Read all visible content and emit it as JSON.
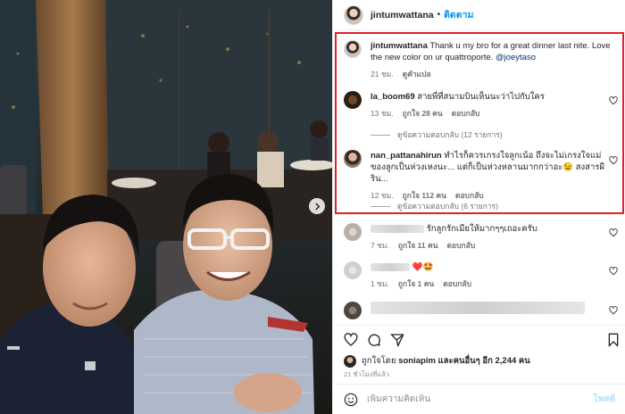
{
  "post": {
    "owner_username": "jintumwattana",
    "follow_label": "ติดตาม",
    "caption": {
      "username": "jintumwattana",
      "text": "Thank u my bro for a great dinner last nite. Love the new color on ur quattroporte.",
      "mention": "@joeytaso",
      "time": "21 ชม.",
      "translate_label": "ดูคำแปล"
    }
  },
  "comments": [
    {
      "username": "la_boom69",
      "text": "สายพี่ที่สนามบินเห็นนะว่าไปกับใคร",
      "time": "13 ชม.",
      "likes": "ถูกใจ 28 คน",
      "reply_label": "ตอบกลับ",
      "view_replies": "ดูข้อความตอบกลับ (12 รายการ)"
    },
    {
      "username": "nan_pattanahirun",
      "text": "ทำไรก็ควรเกรงใจลูกเน้อ ถึงจะไม่เกรงใจแม่ของลูกเป็นห่วงเหงนะ... แต่ก็เป็นห่วงหลานมากกว่าอะ😉 สงสารผีริน...",
      "time": "12 ชม.",
      "likes": "ถูกใจ 112 คน",
      "reply_label": "ตอบกลับ",
      "view_replies": "ดูข้อความตอบกลับ (6 รายการ)"
    },
    {
      "username": "",
      "text": "รักลูกรักเมียให้มากๆๆเถอะครับ",
      "time": "7 ชม.",
      "likes": "ถูกใจ 11 คน",
      "reply_label": "ตอบกลับ"
    },
    {
      "username": "",
      "text": "❤️🤩",
      "time": "1 ชม.",
      "likes": "ถูกใจ 1 คน",
      "reply_label": "ตอบกลับ"
    }
  ],
  "footer": {
    "liked_by_prefix": "ถูกใจโดย",
    "liked_by_user": "soniapim",
    "liked_by_suffix": "และคนอื่นๆ อีก 2,244 คน",
    "post_time": "21 ชั่วโมงที่แล้ว",
    "comment_placeholder": "เพิ่มความคิดเห็น",
    "post_label": "โพสต์"
  },
  "icons": {
    "heart": "heart-icon",
    "comment": "comment-icon",
    "share": "share-icon",
    "bookmark": "bookmark-icon",
    "emoji": "emoji-icon",
    "next": "chevron-right-icon"
  },
  "colors": {
    "link_blue": "#0095f6",
    "highlight_red": "#e0212b",
    "mention": "#00376b"
  }
}
